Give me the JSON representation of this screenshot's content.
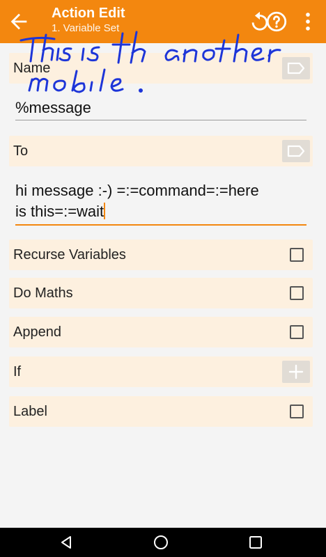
{
  "appbar": {
    "title": "Action Edit",
    "subtitle": "1. Variable Set",
    "icons": [
      "back-arrow-icon",
      "undo-icon",
      "help-icon",
      "overflow-menu-icon"
    ],
    "color": "#f3870f"
  },
  "annotation": {
    "line1": "This is the another",
    "line2": "mobile."
  },
  "form": {
    "name_label": "Name",
    "name_value": "%message",
    "to_label": "To",
    "to_value_line1": "hi message :-) =:=command=:=here",
    "to_value_line2": "is this=:=wait",
    "options": [
      {
        "label": "Recurse Variables",
        "checked": false
      },
      {
        "label": "Do Maths",
        "checked": false
      },
      {
        "label": "Append",
        "checked": false
      }
    ],
    "if_label": "If",
    "label_label": "Label",
    "label_checked": false
  },
  "navbar": {
    "icons": [
      "nav-back-icon",
      "nav-home-icon",
      "nav-recents-icon"
    ]
  }
}
